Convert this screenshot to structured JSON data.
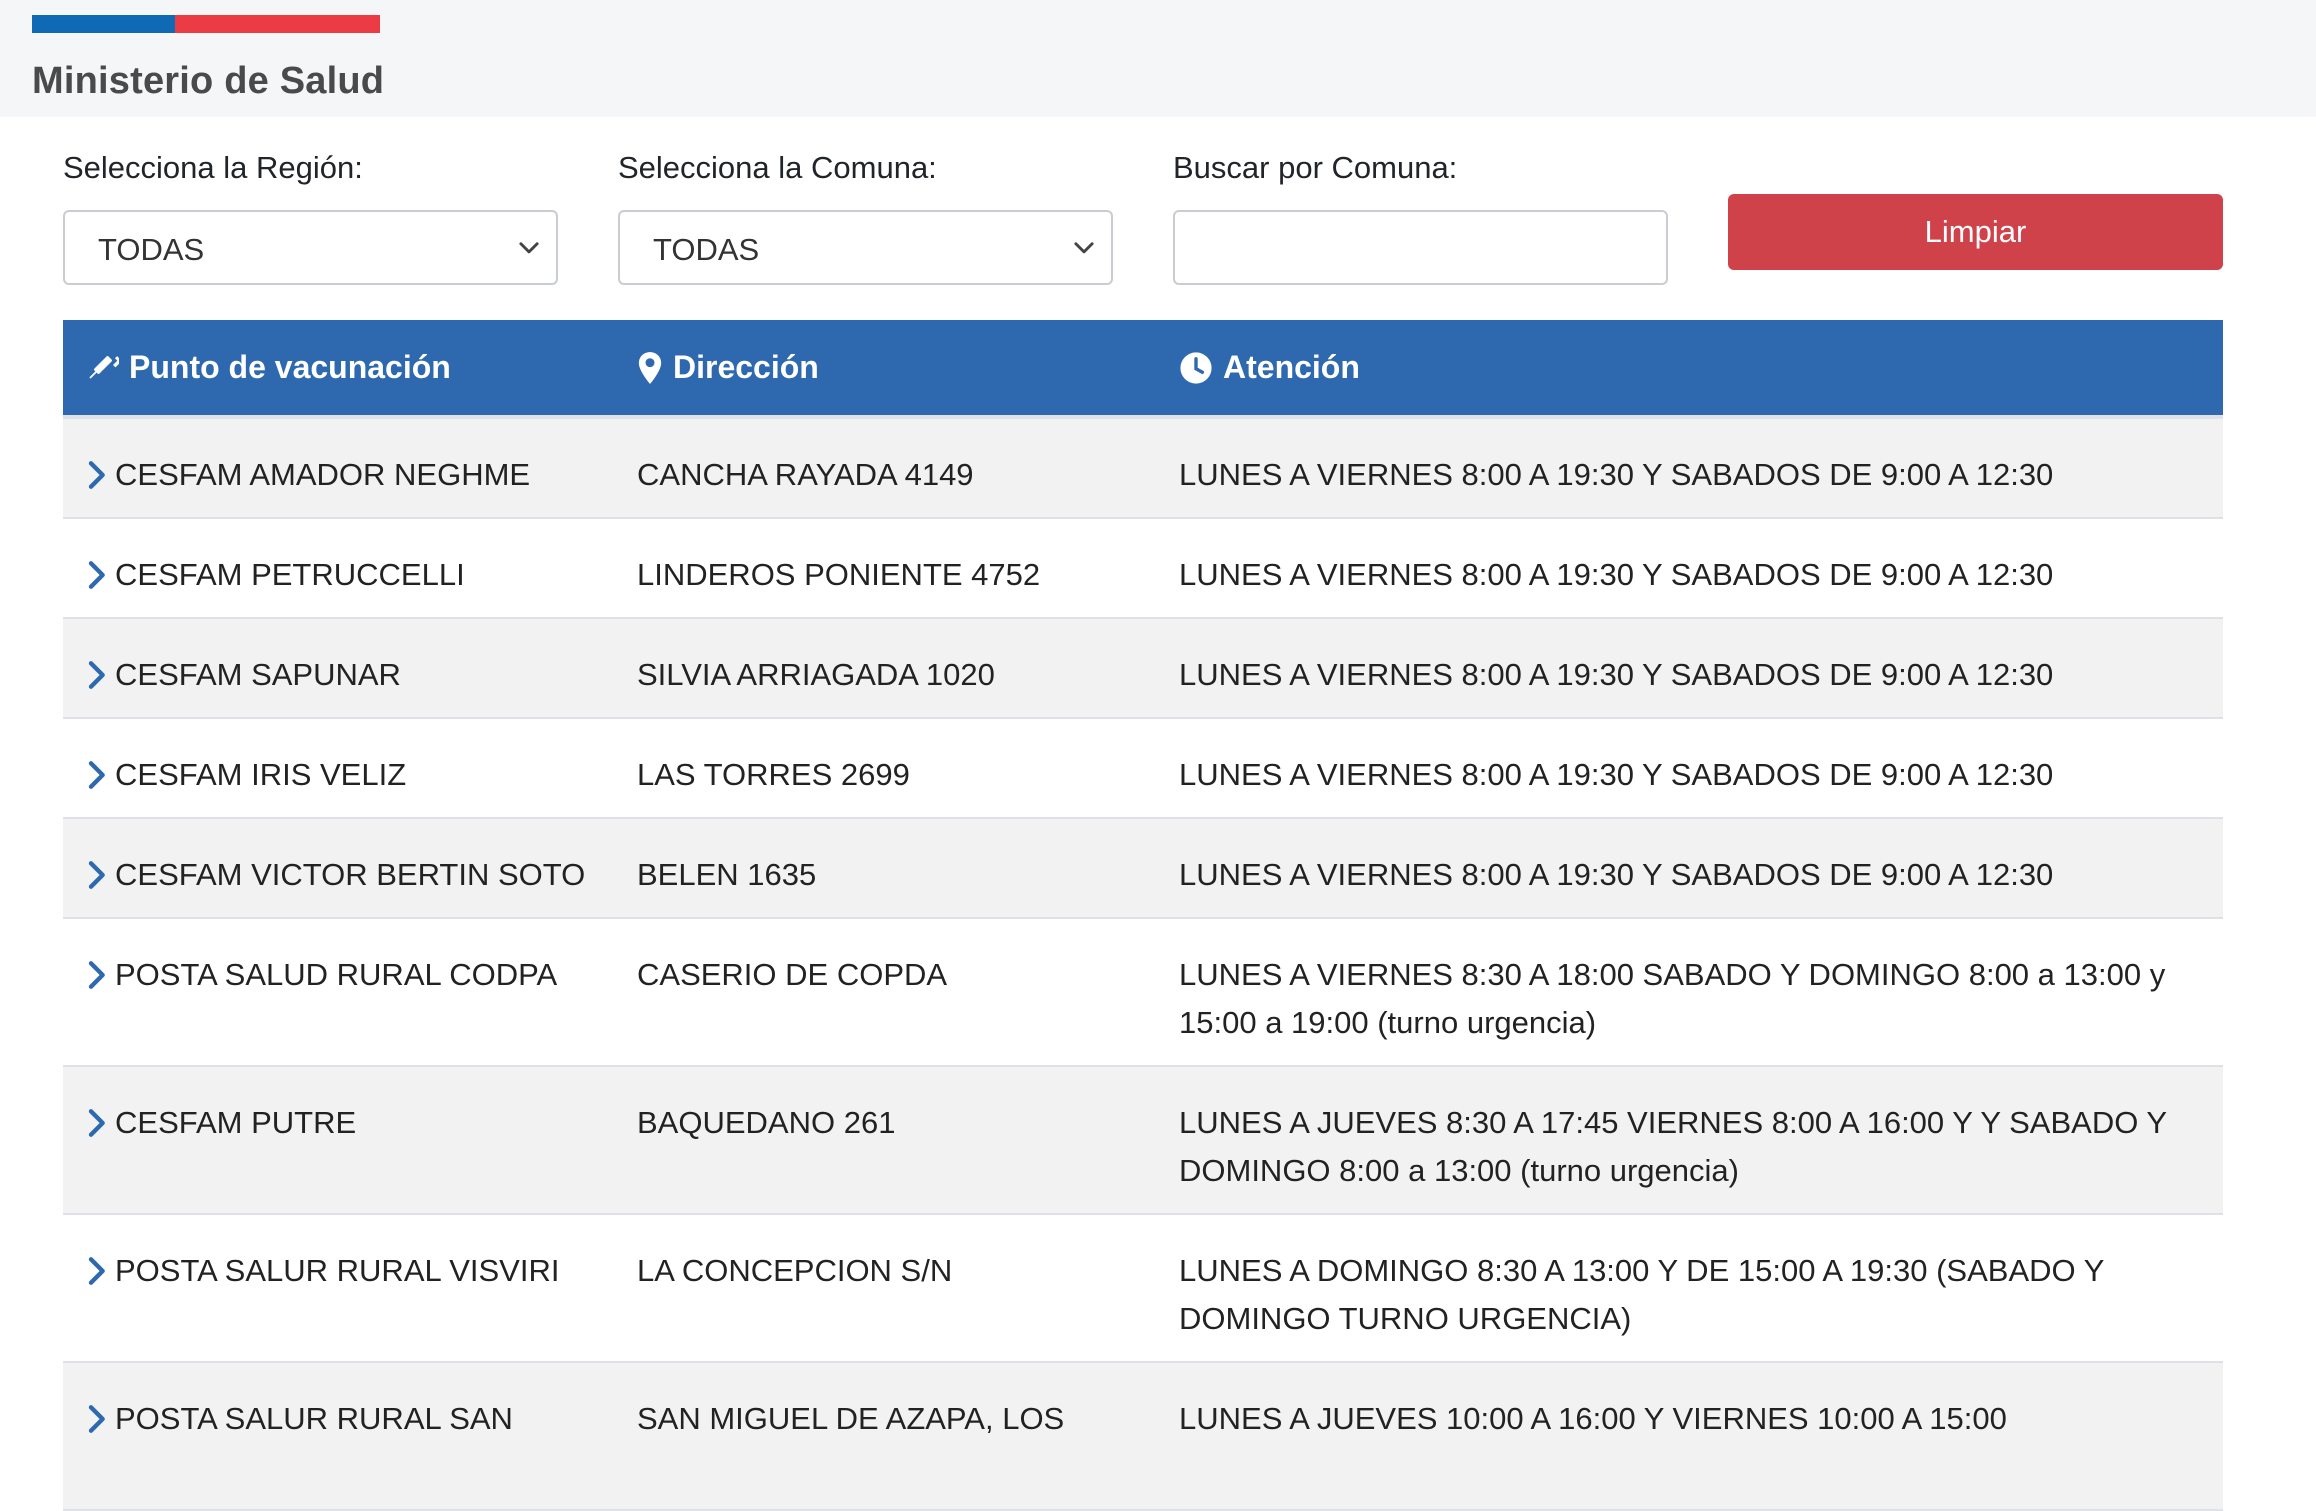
{
  "colors": {
    "gov_blue": "#0f69b4",
    "gov_red": "#eb3c46",
    "header_blue": "#2e69b0",
    "button_red": "#d0424a",
    "chevron_blue": "#2e69b0"
  },
  "brand": {
    "name": "Ministerio de Salud"
  },
  "filters": {
    "region_label": "Selecciona la Región:",
    "region_value": "TODAS",
    "comuna_label": "Selecciona la Comuna:",
    "comuna_value": "TODAS",
    "search_label": "Buscar por Comuna:",
    "search_value": "",
    "clear_label": "Limpiar"
  },
  "table": {
    "headers": [
      {
        "label": "Punto de vacunación",
        "icon": "syringe-icon"
      },
      {
        "label": "Dirección",
        "icon": "map-marker-icon"
      },
      {
        "label": "Atención",
        "icon": "clock-icon"
      }
    ],
    "rows": [
      {
        "name": "CESFAM AMADOR NEGHME",
        "address": "CANCHA RAYADA 4149",
        "hours": "LUNES A VIERNES 8:00 A 19:30 Y SABADOS DE 9:00 A 12:30"
      },
      {
        "name": "CESFAM PETRUCCELLI",
        "address": "LINDEROS PONIENTE 4752",
        "hours": "LUNES A VIERNES 8:00 A 19:30 Y SABADOS DE 9:00 A 12:30"
      },
      {
        "name": "CESFAM SAPUNAR",
        "address": "SILVIA ARRIAGADA 1020",
        "hours": "LUNES A VIERNES 8:00 A 19:30 Y SABADOS DE 9:00 A 12:30"
      },
      {
        "name": "CESFAM IRIS VELIZ",
        "address": "LAS TORRES 2699",
        "hours": "LUNES A VIERNES 8:00 A 19:30 Y SABADOS DE 9:00 A 12:30"
      },
      {
        "name": "CESFAM VICTOR BERTIN SOTO",
        "address": "BELEN 1635",
        "hours": "LUNES A VIERNES 8:00 A 19:30 Y SABADOS DE 9:00 A 12:30"
      },
      {
        "name": "POSTA SALUD RURAL CODPA",
        "address": "CASERIO DE COPDA",
        "hours": "LUNES A VIERNES 8:30 A 18:00 SABADO Y DOMINGO 8:00 a 13:00 y 15:00 a 19:00 (turno urgencia)"
      },
      {
        "name": "CESFAM PUTRE",
        "address": "BAQUEDANO 261",
        "hours": "LUNES A JUEVES 8:30 A 17:45 VIERNES 8:00 A 16:00 Y Y SABADO Y DOMINGO 8:00 a 13:00 (turno urgencia)"
      },
      {
        "name": "POSTA SALUR RURAL VISVIRI",
        "address": "LA CONCEPCION S/N",
        "hours": "LUNES A DOMINGO 8:30 A 13:00 Y DE 15:00 A 19:30 (SABADO Y DOMINGO TURNO URGENCIA)"
      },
      {
        "name": "POSTA SALUR RURAL SAN",
        "address": "SAN MIGUEL DE AZAPA, LOS",
        "hours": "LUNES A JUEVES 10:00 A 16:00 Y VIERNES 10:00 A 15:00"
      }
    ]
  }
}
